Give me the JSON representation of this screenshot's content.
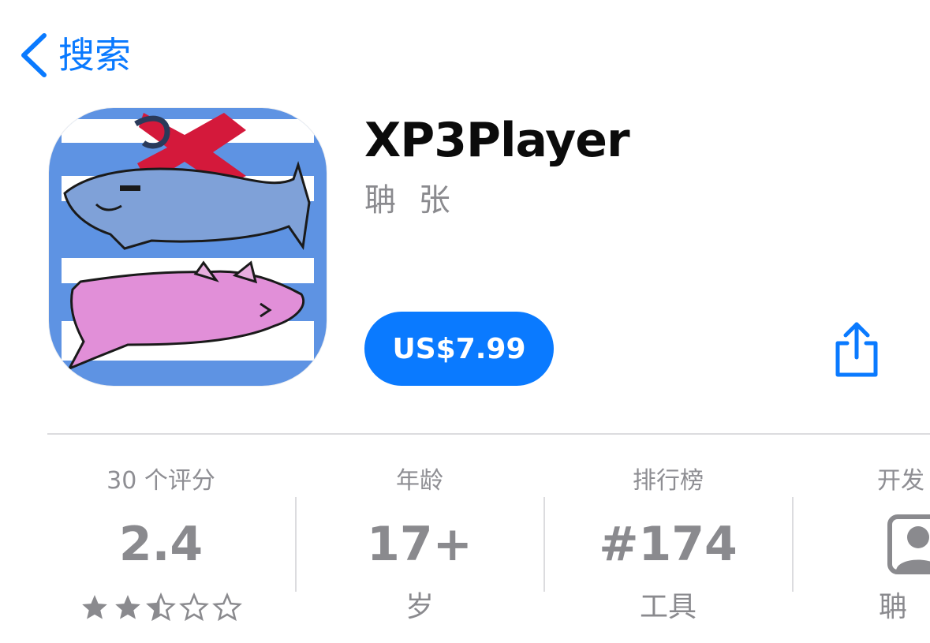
{
  "nav": {
    "back_label": "搜索"
  },
  "app": {
    "title": "XP3Player",
    "developer": "聃 张",
    "price": "US$7.99"
  },
  "info": {
    "ratings": {
      "header": "30 个评分",
      "value": "2.4",
      "stars_filled": 2.4,
      "stars_total": 5
    },
    "age": {
      "header": "年龄",
      "value": "17+",
      "sub": "岁"
    },
    "chart": {
      "header": "排行榜",
      "value": "#174",
      "sub": "工具"
    },
    "developer": {
      "header": "开发",
      "sub": "聃 张"
    }
  },
  "colors": {
    "accent": "#0a7aff",
    "secondary_text": "#8a8a8e"
  },
  "icons": [
    "chevron-left-icon",
    "share-icon",
    "star-icon",
    "person-icon"
  ]
}
